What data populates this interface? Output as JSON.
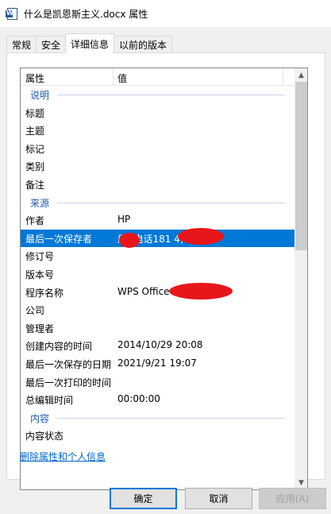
{
  "window": {
    "title": "什么是凯恩斯主义.docx 属性",
    "icon": "word-document-icon"
  },
  "tabs": [
    {
      "label": "常规"
    },
    {
      "label": "安全"
    },
    {
      "label": "详细信息"
    },
    {
      "label": "以前的版本"
    }
  ],
  "list": {
    "header": {
      "property": "属性",
      "value": "值"
    },
    "rows": [
      {
        "type": "group",
        "key": "说明"
      },
      {
        "type": "item",
        "key": "标题",
        "value": ""
      },
      {
        "type": "item",
        "key": "主题",
        "value": ""
      },
      {
        "type": "item",
        "key": "标记",
        "value": ""
      },
      {
        "type": "item",
        "key": "类别",
        "value": ""
      },
      {
        "type": "item",
        "key": "备注",
        "value": ""
      },
      {
        "type": "group",
        "key": "来源"
      },
      {
        "type": "item",
        "key": "作者",
        "value": "HP"
      },
      {
        "type": "item",
        "key": "最后一次保存者",
        "value": "厂      (电话181              4)",
        "selected": true
      },
      {
        "type": "item",
        "key": "修订号",
        "value": ""
      },
      {
        "type": "item",
        "key": "版本号",
        "value": ""
      },
      {
        "type": "item",
        "key": "程序名称",
        "value": "WPS Office                    F1E327B..."
      },
      {
        "type": "item",
        "key": "公司",
        "value": ""
      },
      {
        "type": "item",
        "key": "管理者",
        "value": ""
      },
      {
        "type": "item",
        "key": "创建内容的时间",
        "value": "2014/10/29 20:08"
      },
      {
        "type": "item",
        "key": "最后一次保存的日期",
        "value": "2021/9/21 19:07"
      },
      {
        "type": "item",
        "key": "最后一次打印的时间",
        "value": ""
      },
      {
        "type": "item",
        "key": "总编辑时间",
        "value": "00:00:00"
      },
      {
        "type": "group",
        "key": "内容"
      },
      {
        "type": "item",
        "key": "内容状态",
        "value": ""
      }
    ]
  },
  "remove_link": "删除属性和个人信息",
  "buttons": {
    "ok": "确定",
    "cancel": "取消",
    "apply": "应用(A)"
  },
  "colors": {
    "selection": "#0078d7",
    "link": "#0066cc",
    "redaction": "#e8161a"
  }
}
